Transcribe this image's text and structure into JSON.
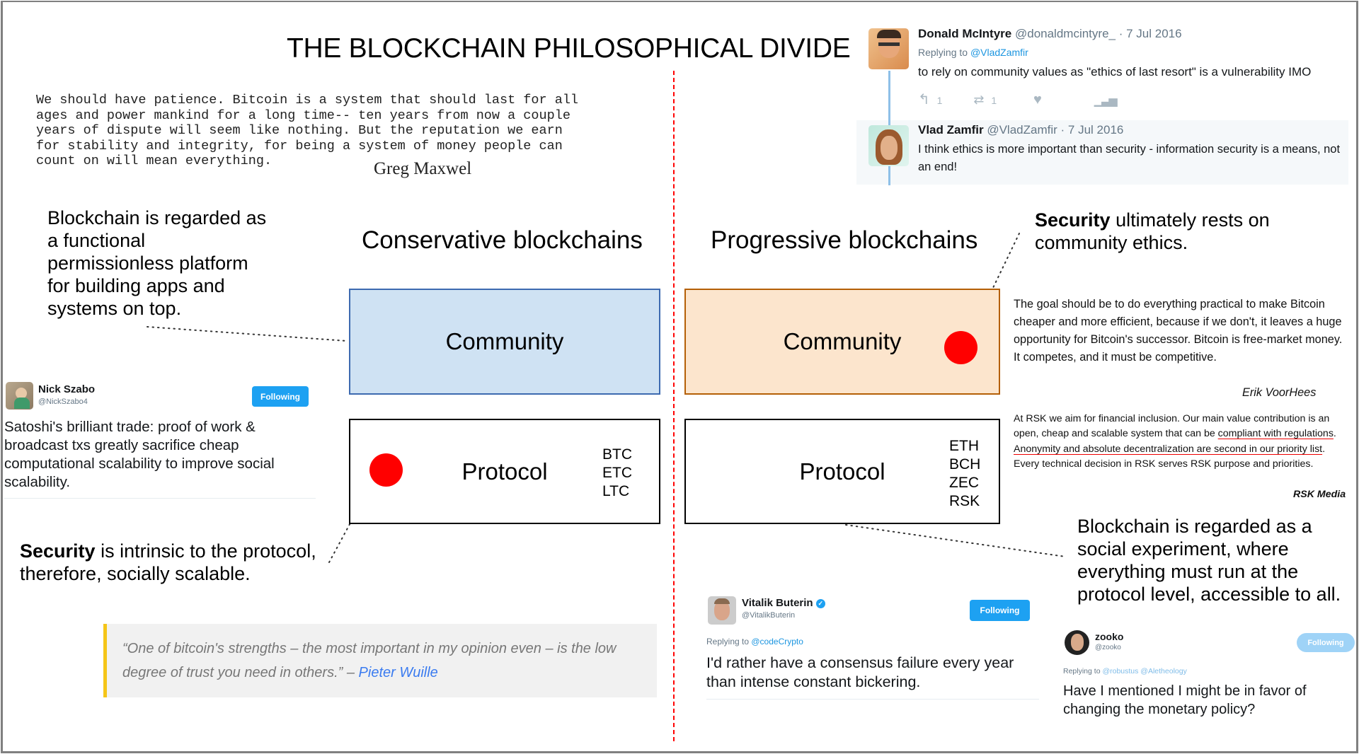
{
  "title": "THE BLOCKCHAIN PHILOSOPHICAL DIVIDE",
  "colors": {
    "divider": "#ff0000",
    "conservative_community_fill": "#cfe2f3",
    "conservative_community_border": "#3d6ab0",
    "progressive_community_fill": "#fce5cd",
    "progressive_community_border": "#b45f06",
    "security_dot": "#ff0000",
    "twitter_blue": "#1da1f2",
    "quote_bar": "#f5c518"
  },
  "left": {
    "greg_quote": {
      "lines": [
        "We should have patience. Bitcoin is a system that should last for all",
        "ages and power mankind for a long time-- ten years from now a couple",
        "years of dispute will seem like nothing. But the reputation we earn",
        "for stability and integrity, for being a system of money people can",
        "count on will mean everything."
      ],
      "author": "Greg Maxwel"
    },
    "annotation_top": "Blockchain is regarded as a functional permissionless platform for building apps and systems on top.",
    "section_title": "Conservative blockchains",
    "community_label": "Community",
    "protocol_label": "Protocol",
    "chains": [
      "BTC",
      "ETC",
      "LTC"
    ],
    "annotation_bottom": {
      "bold": "Security",
      "rest": " is intrinsic to the protocol, therefore, socially scalable."
    },
    "nick_tweet": {
      "name": "Nick Szabo",
      "handle": "@NickSzabo4",
      "follow_label": "Following",
      "text": "Satoshi's brilliant trade: proof of work & broadcast txs greatly sacrifice cheap computational scalability to improve social scalability."
    },
    "wuille_quote": {
      "text": "“One of bitcoin's strengths – the most important in my opinion even – is the low degree of trust you need in others.” – ",
      "author": "Pieter Wuille"
    }
  },
  "right": {
    "thread": {
      "tweet1": {
        "name": "Donald McIntyre",
        "handle": "@donaldmcintyre_",
        "date": "· 7 Jul 2016",
        "replying_prefix": "Replying to ",
        "replying_to": "@VladZamfir",
        "text": "to rely on community values as \"ethics of last resort\" is a vulnerability IMO",
        "reply_count": "1",
        "retweet_count": "1"
      },
      "tweet2": {
        "name": "Vlad Zamfir",
        "handle": "@VladZamfir",
        "date": "· 7 Jul 2016",
        "text": "I think ethics is more important than security - information security is a means, not an end!"
      }
    },
    "section_title": "Progressive blockchains",
    "annotation_top": {
      "bold": "Security",
      "rest": " ultimately rests on community ethics."
    },
    "community_label": "Community",
    "protocol_label": "Protocol",
    "chains": [
      "ETH",
      "BCH",
      "ZEC",
      "RSK"
    ],
    "erik_quote": {
      "text": "The goal should be to do everything practical to make Bitcoin cheaper and more efficient, because if we don't, it leaves a huge opportunity for Bitcoin's successor. Bitcoin is free-market money. It competes, and it must be competitive.",
      "author": "Erik VoorHees"
    },
    "rsk_quote": {
      "part1": "At RSK we aim for financial inclusion. Our main value contribution is an open, cheap and scalable system that can be ",
      "underline1": "compliant with regulations",
      "part2": ". ",
      "underline2": "Anonymity and absolute decentralization are second in our priority list",
      "part3": ". Every technical decision in RSK serves RSK purpose and priorities.",
      "author": "RSK Media"
    },
    "annotation_bottom": "Blockchain is regarded as a social experiment, where everything must run at the protocol level, accessible to all.",
    "vitalik_tweet": {
      "name": "Vitalik Buterin",
      "handle": "@VitalikButerin",
      "follow_label": "Following",
      "replying_prefix": "Replying to ",
      "replying_to": "@codeCrypto",
      "text": "I'd rather have a consensus failure every year than intense constant bickering."
    },
    "zooko_tweet": {
      "name": "zooko",
      "handle": "@zooko",
      "follow_label": "Following",
      "replying_prefix": "Replying to ",
      "replying_to": "@robustus @Aletheology",
      "text": "Have I mentioned I might be in favor of changing the monetary policy?"
    }
  }
}
